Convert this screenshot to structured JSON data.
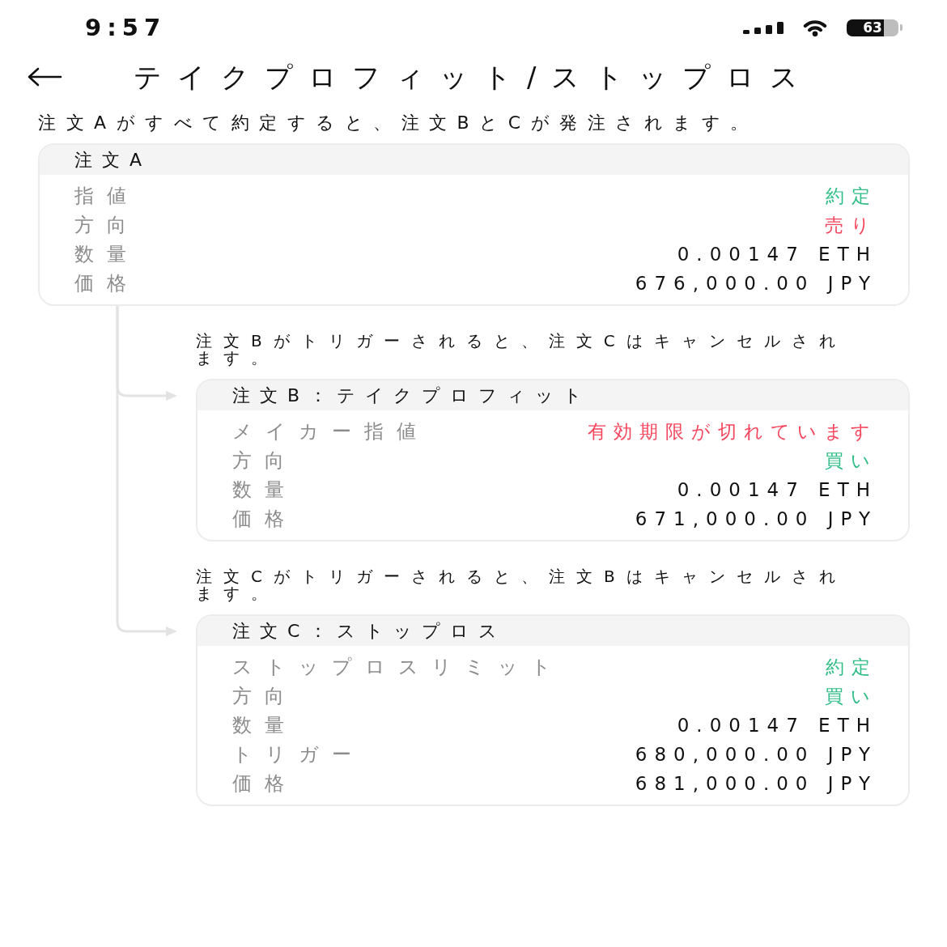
{
  "status_bar": {
    "time": "9:57",
    "battery": "63"
  },
  "header": {
    "title": "テイクプロフィット/ストップロス"
  },
  "intro": "注文Aがすべて約定すると、注文BとCが発注されます。",
  "parent_order": {
    "title": "注文A",
    "rows": [
      {
        "label": "指値",
        "value": "約定",
        "color": "#2ebd85"
      },
      {
        "label": "方向",
        "value": "売り",
        "color": "#f6465d"
      },
      {
        "label": "数量",
        "value": "0.00147 ETH",
        "color": "#111111"
      },
      {
        "label": "価格",
        "value": "676,000.00 JPY",
        "color": "#111111"
      }
    ]
  },
  "linked_orders": [
    {
      "note": "注文Bがトリガーされると、注文Cはキャンセルされます。",
      "title": "注文B：テイクプロフィット",
      "rows": [
        {
          "label": "メイカー指値",
          "value": "有効期限が切れています",
          "color": "#f6465d"
        },
        {
          "label": "方向",
          "value": "買い",
          "color": "#2ebd85"
        },
        {
          "label": "数量",
          "value": "0.00147 ETH",
          "color": "#111111"
        },
        {
          "label": "価格",
          "value": "671,000.00 JPY",
          "color": "#111111"
        }
      ]
    },
    {
      "note": "注文Cがトリガーされると、注文Bはキャンセルされます。",
      "title": "注文C：ストップロス",
      "rows": [
        {
          "label": "ストップロスリミット",
          "value": "約定",
          "color": "#2ebd85"
        },
        {
          "label": "方向",
          "value": "買い",
          "color": "#2ebd85"
        },
        {
          "label": "数量",
          "value": "0.00147 ETH",
          "color": "#111111"
        },
        {
          "label": "トリガー",
          "value": "680,000.00 JPY",
          "color": "#111111"
        },
        {
          "label": "価格",
          "value": "681,000.00 JPY",
          "color": "#111111"
        }
      ]
    }
  ]
}
